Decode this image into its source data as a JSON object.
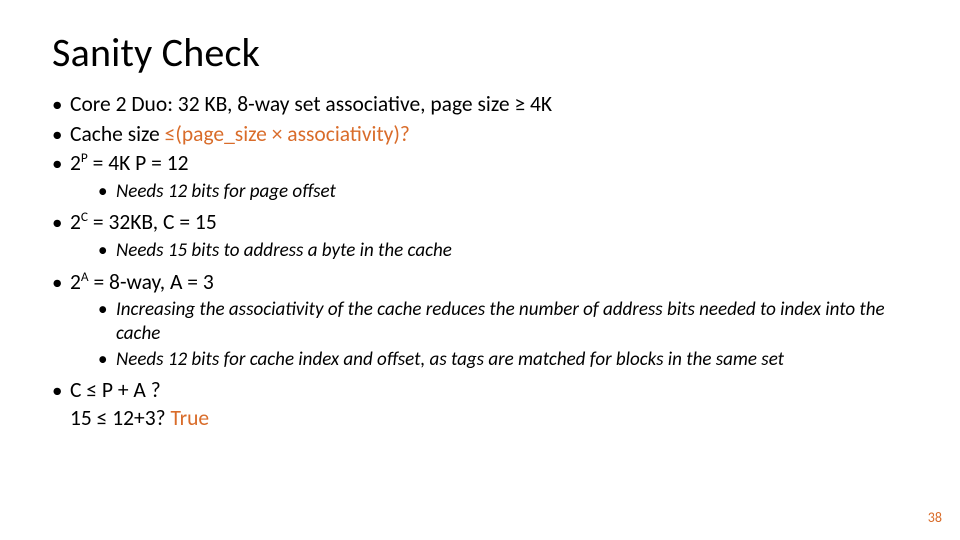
{
  "title": "Sanity Check",
  "bullets": {
    "b1": "Core 2 Duo: 32 KB, 8-way set associative, page size ≥ 4K",
    "b2_pre": "Cache size ",
    "b2_accent": "≤(page_size × associativity)?",
    "b3_pre": "2",
    "b3_sup": "P",
    "b3_post": " = 4K P = 12",
    "b3_sub1": "Needs 12 bits for page offset",
    "b4_pre": "2",
    "b4_sup": "C",
    "b4_post": " = 32KB, C = 15",
    "b4_sub1": "Needs 15 bits to address a byte in the cache",
    "b5_pre": "2",
    "b5_sup": "A",
    "b5_post": " = 8-way,  A = 3",
    "b5_sub1": "Increasing the associativity of the cache reduces the number of address bits needed to index into the cache",
    "b5_sub2": "Needs  12 bits for cache index and offset, as tags are matched for blocks in the same set",
    "b6_line1": "C ≤ P + A ?",
    "b6_line2_pre": "15 ≤ 12+3? ",
    "b6_line2_accent": "True"
  },
  "page_number": "38",
  "colors": {
    "accent": "#d96c2a",
    "text": "#000000",
    "background": "#ffffff"
  }
}
